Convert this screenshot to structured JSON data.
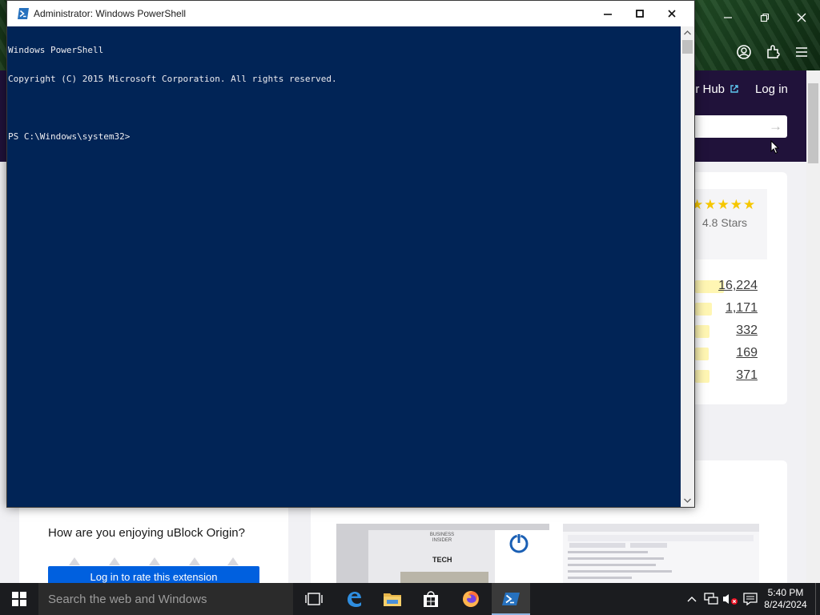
{
  "powershell": {
    "title": "Administrator: Windows PowerShell",
    "lines": [
      "Windows PowerShell",
      "Copyright (C) 2015 Microsoft Corporation. All rights reserved.",
      "",
      "PS C:\\Windows\\system32>"
    ],
    "background_color": "#012456",
    "text_color": "#eeedf0"
  },
  "browser_page": {
    "nav": {
      "hub_link": "er Hub",
      "login": "Log in"
    },
    "rating": {
      "stars_label": "4.8 Stars",
      "counts": [
        "16,224",
        "1,171",
        "332",
        "169",
        "371"
      ],
      "shares": [
        0.86,
        0.42,
        0.32,
        0.28,
        0.3
      ]
    },
    "review_prompt": {
      "question": "How are you enjoying uBlock Origin?",
      "login_button": "Log in to rate this extension"
    },
    "screenshot1_text": {
      "brand": "BUSINESS INSIDER",
      "section": "TECH"
    }
  },
  "taskbar": {
    "search_placeholder": "Search the web and Windows",
    "apps": [
      "task-view",
      "edge",
      "file-explorer",
      "store",
      "firefox",
      "powershell"
    ],
    "active_app": "powershell",
    "clock": {
      "time": "5:40 PM",
      "date": "8/24/2024"
    }
  }
}
